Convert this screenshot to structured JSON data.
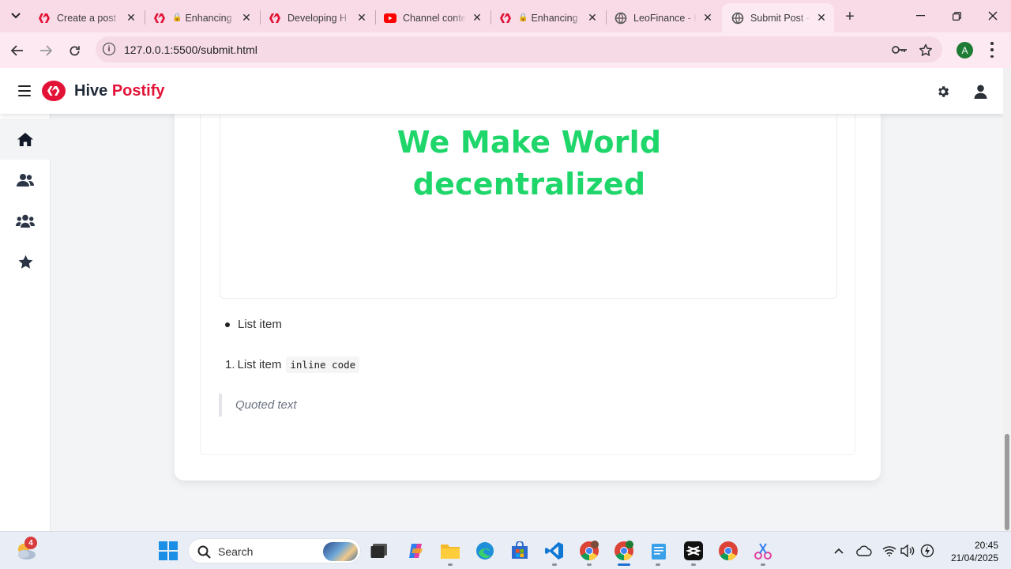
{
  "browser": {
    "tabs": [
      {
        "title": "Create a post",
        "favicon": "hive-icon",
        "locked": false
      },
      {
        "title": "Enhancing",
        "favicon": "hive-icon",
        "locked": true
      },
      {
        "title": "Developing H",
        "favicon": "hive-icon",
        "locked": false
      },
      {
        "title": "Channel conte",
        "favicon": "youtube-icon",
        "locked": false
      },
      {
        "title": "Enhancing",
        "favicon": "hive-icon",
        "locked": true
      },
      {
        "title": "LeoFinance - H",
        "favicon": "globe-icon",
        "locked": false
      },
      {
        "title": "Submit Post -",
        "favicon": "globe-icon",
        "locked": false,
        "active": true
      }
    ],
    "url": "127.0.0.1:5500/submit.html",
    "profile_initial": "A"
  },
  "app": {
    "brand_prefix": "Hive",
    "brand_accent": "Postify",
    "accent_color": "#e31337",
    "sidebar": [
      {
        "icon": "home-icon",
        "active": true
      },
      {
        "icon": "users-icon",
        "active": false
      },
      {
        "icon": "community-icon",
        "active": false
      },
      {
        "icon": "star-icon",
        "active": false
      }
    ]
  },
  "preview": {
    "hero_line1": "We Make World",
    "hero_line2": "decentralized",
    "hero_color": "#1ed66a",
    "bullet_item": "List item",
    "ordered_number": "1.",
    "ordered_item": "List item",
    "inline_code": "inline code",
    "quote": "Quoted text"
  },
  "taskbar": {
    "weather_badge": "4",
    "search_label": "Search",
    "time": "20:45",
    "date": "21/04/2025"
  }
}
